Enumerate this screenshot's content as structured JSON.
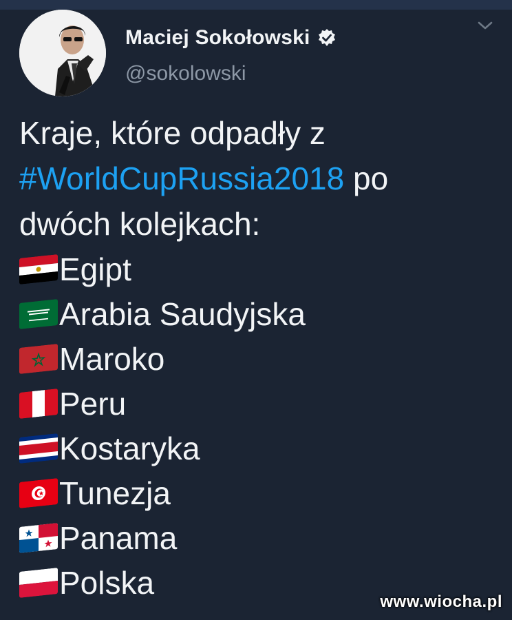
{
  "header": {
    "display_name": "Maciej Sokołowski",
    "handle": "@sokolowski",
    "verified_icon": "verified-badge-icon",
    "menu_icon": "chevron-down-icon"
  },
  "tweet": {
    "line1": "Kraje, które odpadły z",
    "hashtag": "#WorldCupRussia2018",
    "after_hashtag": " po",
    "line3": "dwóch kolejkach:",
    "countries": [
      {
        "name": "Egipt",
        "flag": "egypt-flag"
      },
      {
        "name": "Arabia Saudyjska",
        "flag": "saudi-arabia-flag"
      },
      {
        "name": "Maroko",
        "flag": "morocco-flag"
      },
      {
        "name": "Peru",
        "flag": "peru-flag"
      },
      {
        "name": "Kostaryka",
        "flag": "costa-rica-flag"
      },
      {
        "name": "Tunezja",
        "flag": "tunisia-flag"
      },
      {
        "name": "Panama",
        "flag": "panama-flag"
      },
      {
        "name": "Polska",
        "flag": "poland-flag"
      }
    ]
  },
  "colors": {
    "background": "#1b2433",
    "hashtag": "#1da1f2",
    "handle": "#8d98a6"
  },
  "watermark": "www.wiocha.pl"
}
